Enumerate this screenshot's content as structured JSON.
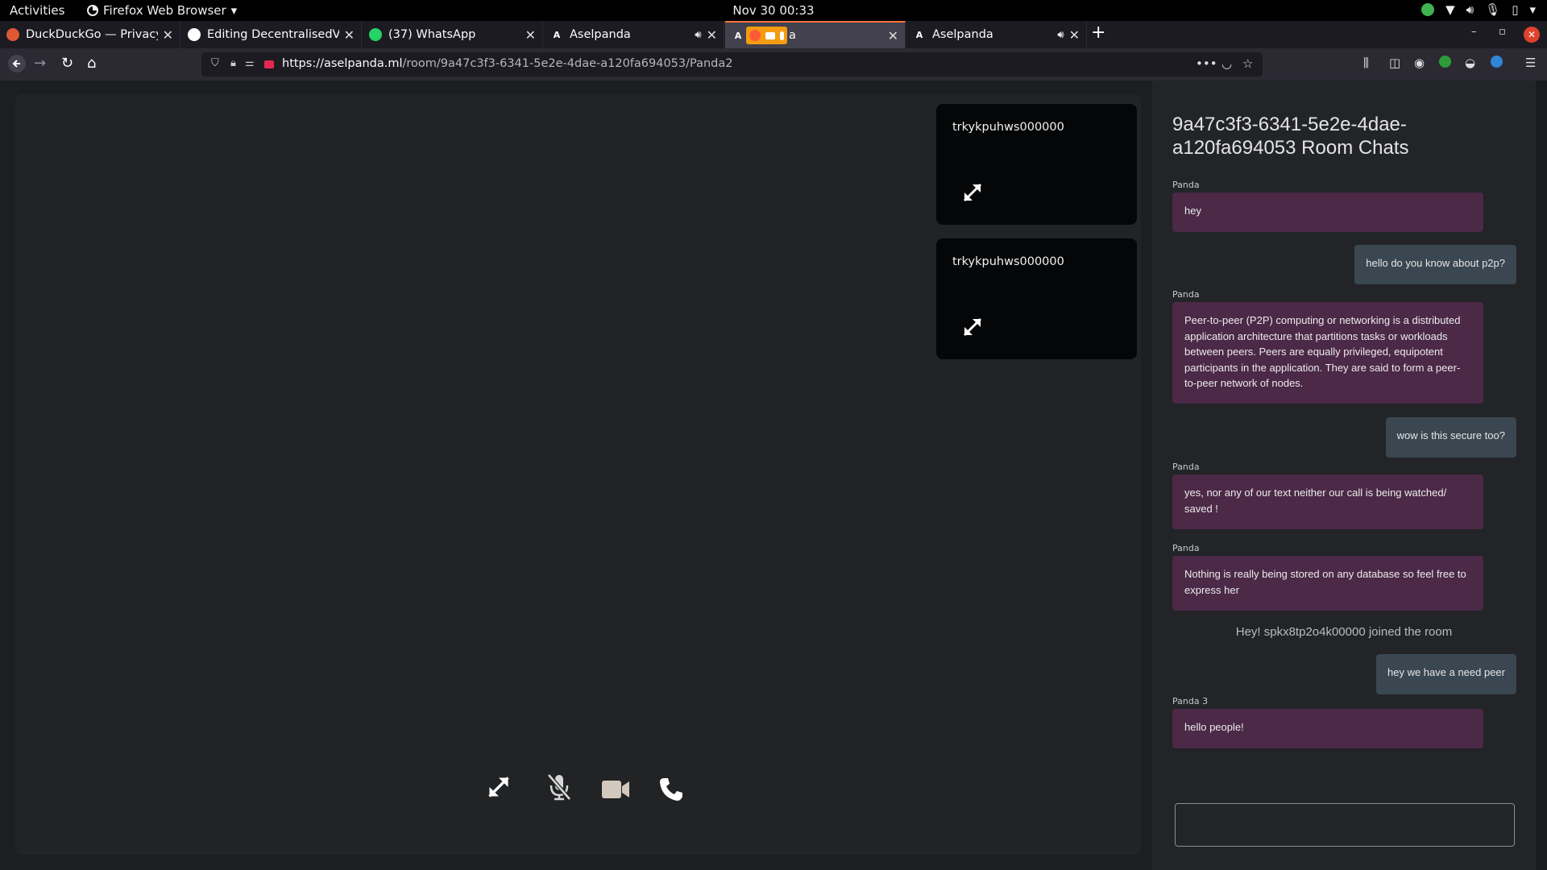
{
  "system_bar": {
    "activities": "Activities",
    "app_menu": "Firefox Web Browser",
    "clock": "Nov 30  00:33"
  },
  "tabs": [
    {
      "title": "DuckDuckGo — Privacy,",
      "favicon_color": "#de5833"
    },
    {
      "title": "Editing DecentralisedVid",
      "favicon_color": "#ffffff"
    },
    {
      "title": "(37) WhatsApp",
      "favicon_color": "#25d366",
      "badge": "37"
    },
    {
      "title": "Aselpanda",
      "favicon": "A",
      "audio": true
    },
    {
      "title": "a",
      "favicon": "A",
      "active": true,
      "sharing": true
    },
    {
      "title": "Aselpanda",
      "favicon": "A",
      "audio": true
    }
  ],
  "address_bar": {
    "url_host": "https://aselpanda.ml",
    "url_path": "/room/9a47c3f3-6341-5e2e-4dae-a120fa694053/Panda2"
  },
  "participants": [
    {
      "name": "trkykpuhws000000"
    },
    {
      "name": "trkykpuhws000000"
    }
  ],
  "chat": {
    "title": "9a47c3f3-6341-5e2e-4dae-a120fa694053 Room Chats",
    "messages": [
      {
        "sender": "Panda",
        "text": "hey"
      },
      {
        "text": "hello do you know about p2p?"
      },
      {
        "sender": "Panda",
        "text": "Peer-to-peer (P2P) computing or networking is a distributed application architecture that partitions tasks or workloads between peers. Peers are equally privileged, equipotent participants in the application. They are said to form a peer-to-peer network of nodes."
      },
      {
        "text": "wow is this secure too?"
      },
      {
        "sender": "Panda",
        "text": "yes, nor any of our text neither our call is being watched/ saved !"
      },
      {
        "sender": "Panda",
        "text": "Nothing is really being stored on any database so feel free to express her"
      },
      {
        "system": "Hey! spkx8tp2o4k00000 joined the room"
      },
      {
        "text": "hey we have a need peer"
      },
      {
        "sender": "Panda 3",
        "text": "hello people!"
      }
    ],
    "input_value": ""
  },
  "colors": {
    "incoming_bubble": "#4b2947",
    "outgoing_bubble": "#3a4751",
    "active_tab_accent": "#ff7139",
    "video_area": "#212325"
  }
}
